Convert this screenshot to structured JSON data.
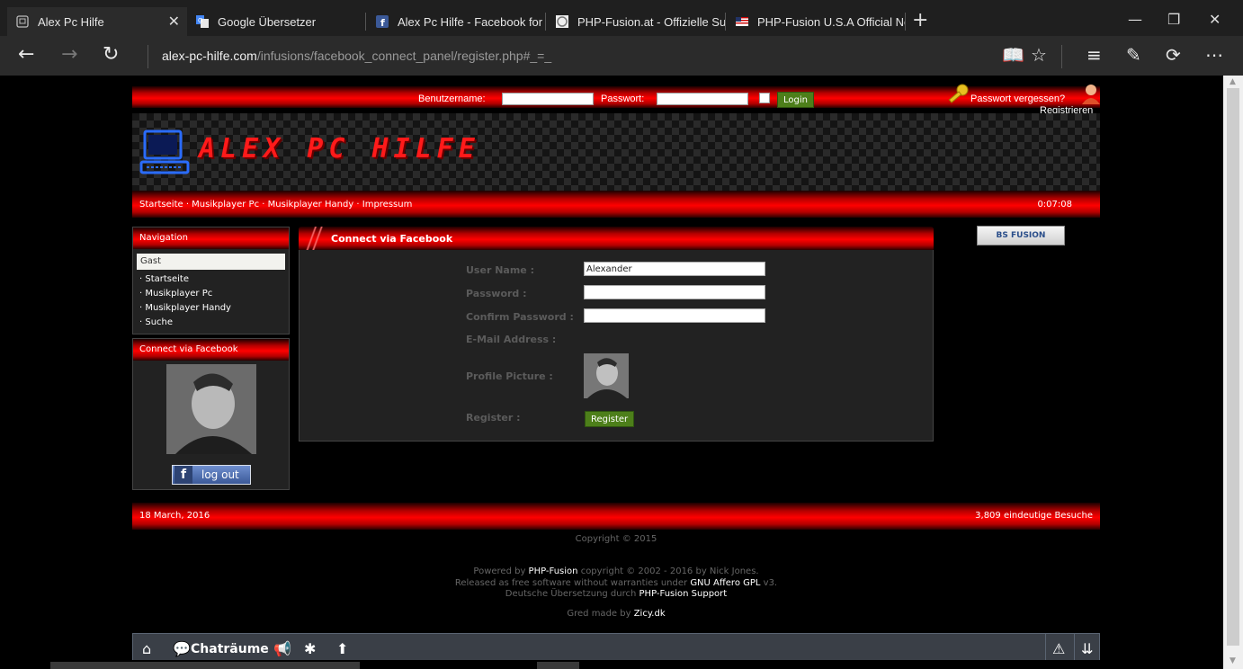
{
  "browser": {
    "tabs": [
      {
        "title": "Alex Pc Hilfe",
        "icon": "page-icon",
        "active": true
      },
      {
        "title": "Google Übersetzer",
        "icon": "google-translate-icon",
        "active": false
      },
      {
        "title": "Alex Pc Hilfe - Facebook for",
        "icon": "facebook-icon",
        "active": false
      },
      {
        "title": "PHP-Fusion.at - Offizielle Su",
        "icon": "php-fusion-icon",
        "active": false
      },
      {
        "title": "PHP-Fusion U.S.A Official Ne",
        "icon": "us-flag-icon",
        "active": false
      }
    ],
    "url_host": "alex-pc-hilfe.com",
    "url_path": "/infusions/facebook_connect_panel/register.php#_=_"
  },
  "header": {
    "username_label": "Benutzername:",
    "password_label": "Passwort:",
    "login_button": "Login",
    "lost_password": "Passwort vergessen?",
    "register": "Registrieren",
    "logo_text": "ALEX PC HILFE",
    "menu": "Startseite · Musikplayer Pc · Musikplayer Handy · Impressum",
    "clock": "0:07:08"
  },
  "sidebar": {
    "navigation_title": "Navigation",
    "guest": "Gast",
    "items": [
      "· Startseite",
      "· Musikplayer Pc",
      "· Musikplayer Handy",
      "· Suche"
    ],
    "facebook_title": "Connect via Facebook",
    "logout": "log out"
  },
  "main": {
    "title": "Connect via Facebook",
    "user_name_label": "User Name :",
    "user_name_value": "Alexander",
    "password_label": "Password :",
    "confirm_password_label": "Confirm Password :",
    "email_label": "E-Mail Address :",
    "profile_picture_label": "Profile Picture :",
    "register_label": "Register :",
    "register_button": "Register"
  },
  "ad": {
    "text": "BS FUSION"
  },
  "footer": {
    "date": "18 March, 2016",
    "visits": "3,809 eindeutige Besuche",
    "copyright": "Copyright © 2015",
    "powered_prefix": "Powered by ",
    "powered_link": "PHP-Fusion",
    "powered_suffix": " copyright © 2002 - 2016 by Nick Jones.",
    "released_prefix": "Released as free software without warranties under ",
    "released_link": "GNU Affero GPL",
    "released_suffix": " v3.",
    "translation_prefix": "Deutsche Übersetzung durch ",
    "translation_link": "PHP-Fusion Support",
    "gred_prefix": "Gred made by ",
    "gred_link": "Zicy.dk"
  },
  "chatbar": {
    "label": "Chaträume"
  },
  "colors": {
    "accent_red": "#ff0000",
    "button_green": "#4d7f1a",
    "facebook_blue": "#3b5998"
  }
}
